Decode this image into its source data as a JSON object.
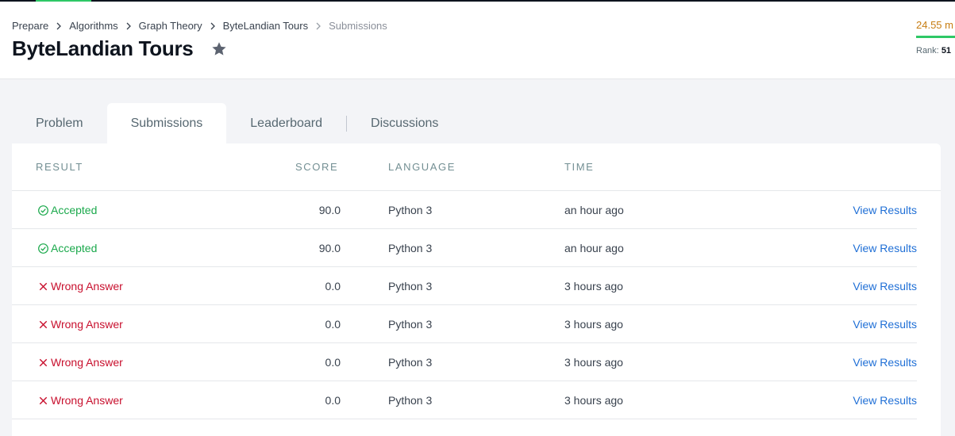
{
  "colors": {
    "accent_green": "#2ec866",
    "accepted": "#1ba94c",
    "wrong": "#c8102e",
    "link": "#1f6fd6",
    "score_orange": "#c77d12"
  },
  "breadcrumb": {
    "items": [
      "Prepare",
      "Algorithms",
      "Graph Theory",
      "ByteLandian Tours"
    ],
    "current": "Submissions"
  },
  "header": {
    "title": "ByteLandian Tours",
    "star_icon": "star-icon"
  },
  "profile": {
    "score": "24.55 m",
    "rank_label": "Rank:",
    "rank_value": "51"
  },
  "tabs": [
    {
      "label": "Problem"
    },
    {
      "label": "Submissions"
    },
    {
      "label": "Leaderboard"
    },
    {
      "label": "Discussions"
    }
  ],
  "table": {
    "headers": {
      "result": "RESULT",
      "score": "SCORE",
      "language": "LANGUAGE",
      "time": "TIME"
    },
    "rows": [
      {
        "status": "ok",
        "result": "Accepted",
        "score": "90.0",
        "language": "Python 3",
        "time": "an hour ago",
        "action": "View Results"
      },
      {
        "status": "ok",
        "result": "Accepted",
        "score": "90.0",
        "language": "Python 3",
        "time": "an hour ago",
        "action": "View Results"
      },
      {
        "status": "bad",
        "result": "Wrong Answer",
        "score": "0.0",
        "language": "Python 3",
        "time": "3 hours ago",
        "action": "View Results"
      },
      {
        "status": "bad",
        "result": "Wrong Answer",
        "score": "0.0",
        "language": "Python 3",
        "time": "3 hours ago",
        "action": "View Results"
      },
      {
        "status": "bad",
        "result": "Wrong Answer",
        "score": "0.0",
        "language": "Python 3",
        "time": "3 hours ago",
        "action": "View Results"
      },
      {
        "status": "bad",
        "result": "Wrong Answer",
        "score": "0.0",
        "language": "Python 3",
        "time": "3 hours ago",
        "action": "View Results"
      }
    ]
  }
}
